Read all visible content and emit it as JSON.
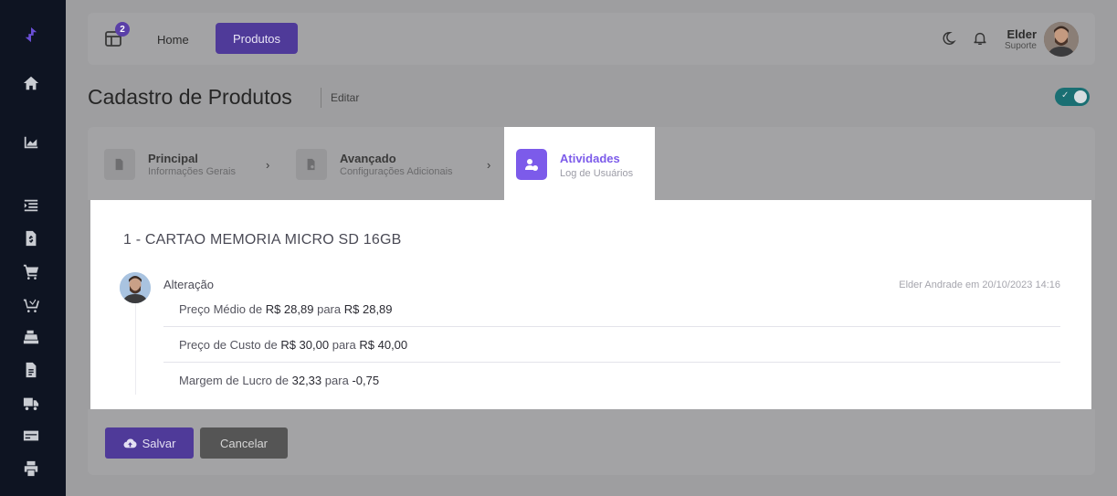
{
  "header": {
    "notification_count": "2",
    "nav_home": "Home",
    "nav_produtos": "Produtos",
    "user_name": "Elder",
    "user_role": "Suporte"
  },
  "page": {
    "title": "Cadastro de Produtos",
    "subtitle": "Editar"
  },
  "steps": [
    {
      "title": "Principal",
      "desc": "Informações Gerais"
    },
    {
      "title": "Avançado",
      "desc": "Configurações Adicionais"
    },
    {
      "title": "Atividades",
      "desc": "Log de Usuários"
    }
  ],
  "product": {
    "title": "1 - CARTAO MEMORIA MICRO SD 16GB"
  },
  "activity": {
    "type": "Alteração",
    "meta": "Elder Andrade em 20/10/2023 14:16",
    "changes": [
      {
        "label": "Preço Médio",
        "from_word": "de",
        "from": "R$ 28,89",
        "to_word": "para",
        "to": "R$ 28,89"
      },
      {
        "label": "Preço de Custo",
        "from_word": "de",
        "from": "R$ 30,00",
        "to_word": "para",
        "to": "R$ 40,00"
      },
      {
        "label": "Margem de Lucro",
        "from_word": "de",
        "from": "32,33",
        "to_word": "para",
        "to": "-0,75"
      }
    ]
  },
  "actions": {
    "save": "Salvar",
    "cancel": "Cancelar"
  },
  "colors": {
    "primary": "#7c5bea",
    "primary_dark": "#4f3a99",
    "sidebar": "#0e1422",
    "toggle": "#1a6f73"
  },
  "icons": {
    "sidebar": [
      "logo-icon",
      "home-icon",
      "chart-icon",
      "list-icon",
      "document-dollar-icon",
      "cart-icon",
      "cart-return-icon",
      "cash-register-icon",
      "file-icon",
      "truck-icon",
      "card-icon",
      "printer-icon"
    ]
  }
}
